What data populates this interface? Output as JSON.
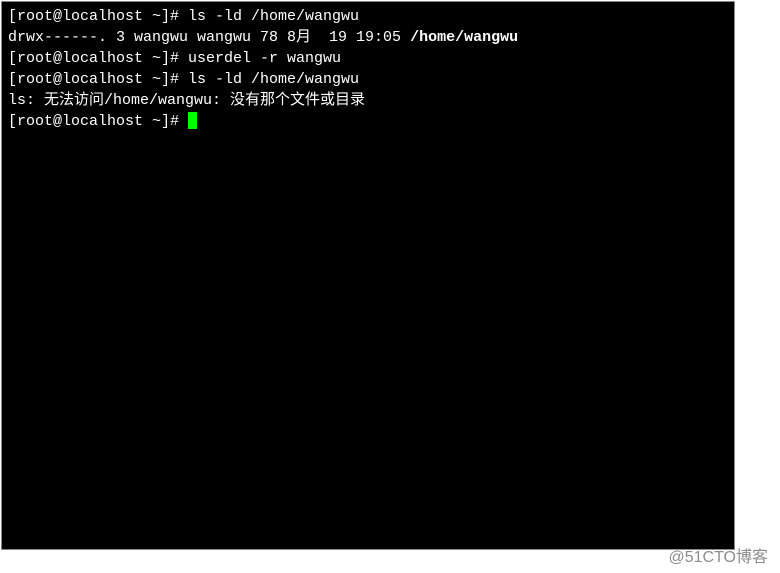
{
  "terminal": {
    "lines": [
      {
        "prompt": "[root@localhost ~]# ",
        "command": "ls -ld /home/wangwu",
        "output_perm": "drwx------. 3 wangwu wangwu 78 8月  19 19:05 ",
        "output_path": "/home/wangwu"
      },
      {
        "prompt": "[root@localhost ~]# ",
        "command": "userdel -r wangwu"
      },
      {
        "prompt": "[root@localhost ~]# ",
        "command": "ls -ld /home/wangwu"
      },
      {
        "error": "ls: 无法访问/home/wangwu: 没有那个文件或目录"
      },
      {
        "prompt": "[root@localhost ~]# "
      }
    ]
  },
  "watermark": "@51CTO博客"
}
